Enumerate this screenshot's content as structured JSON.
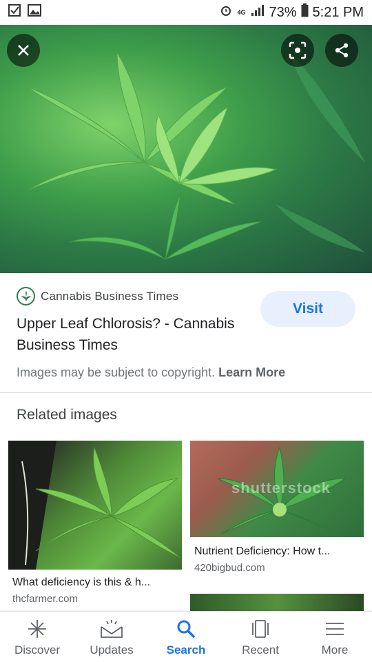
{
  "status_bar": {
    "battery": "73%",
    "time": "5:21 PM",
    "network": "4G"
  },
  "hero": {
    "close_icon": "close-icon",
    "lens_icon": "lens-icon",
    "share_icon": "share-icon"
  },
  "source": {
    "name": "Cannabis Business Times",
    "title": "Upper Leaf Chlorosis? - Cannabis Business Times",
    "visit_label": "Visit",
    "copyright_text": "Images may be subject to copyright.",
    "learn_more_label": "Learn More"
  },
  "related": {
    "heading": "Related images",
    "items": [
      {
        "caption": "What deficiency is this & h...",
        "domain": "thcfarmer.com"
      },
      {
        "caption": "Nutrient Deficiency: How t...",
        "domain": "420bigbud.com",
        "watermark": "shutterstock"
      }
    ]
  },
  "bottom_nav": {
    "items": [
      {
        "label": "Discover",
        "icon": "asterisk-icon"
      },
      {
        "label": "Updates",
        "icon": "inbox-icon"
      },
      {
        "label": "Search",
        "icon": "search-icon",
        "active": true
      },
      {
        "label": "Recent",
        "icon": "recent-icon"
      },
      {
        "label": "More",
        "icon": "menu-icon"
      }
    ]
  },
  "colors": {
    "accent": "#1a73e8",
    "visit_bg": "#e8f0fe"
  }
}
